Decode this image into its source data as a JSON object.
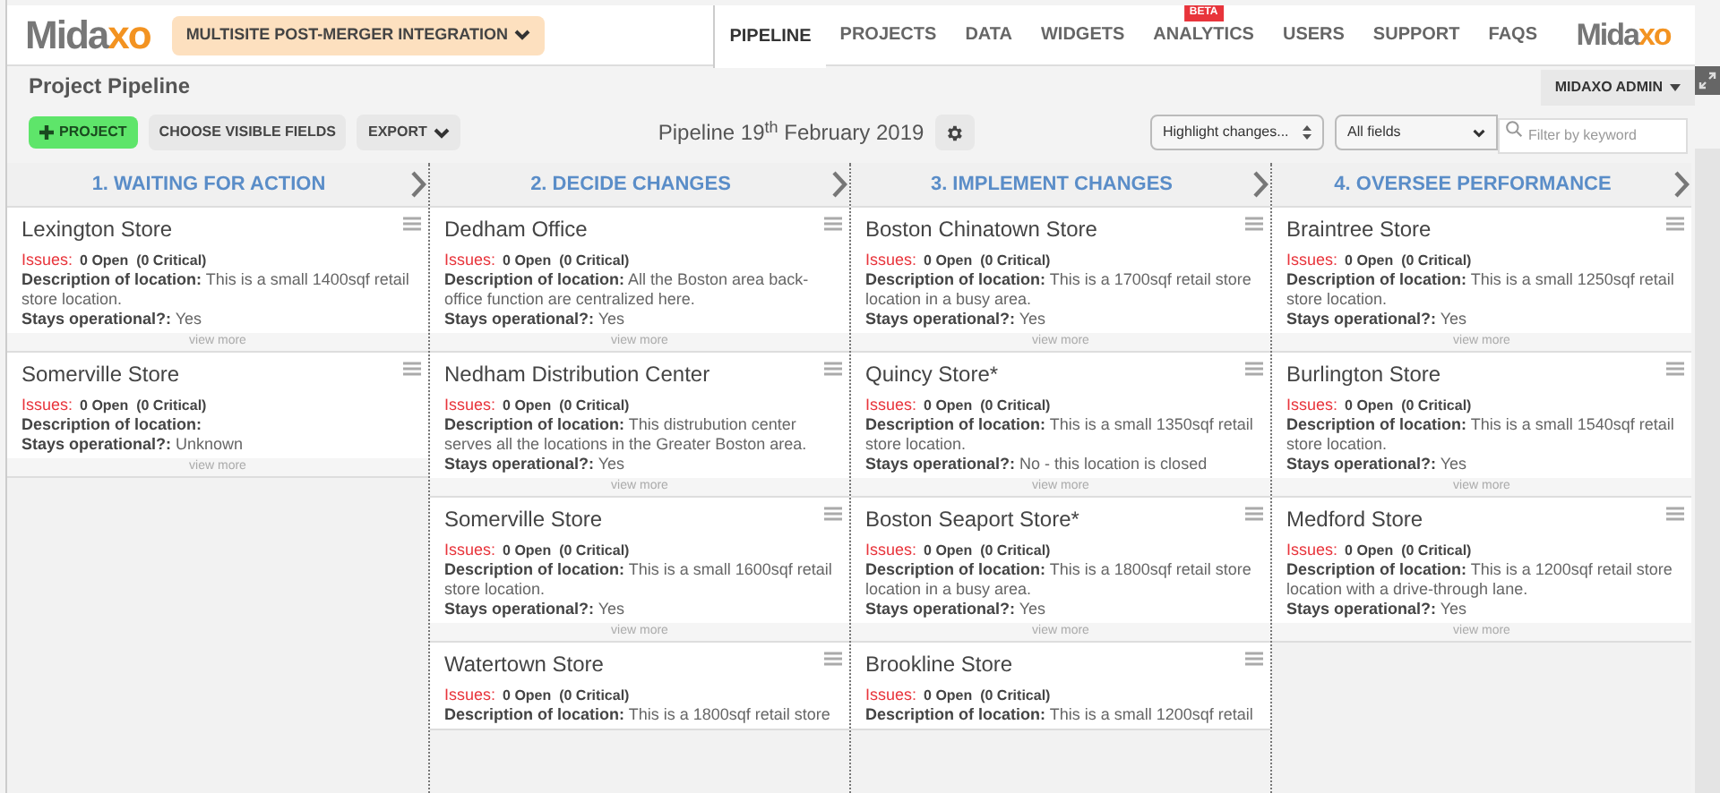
{
  "app": {
    "logo": {
      "main": "Mida",
      "accent": "xo"
    },
    "project_selector": "MULTISITE POST-MERGER INTEGRATION"
  },
  "nav": [
    {
      "label": "PIPELINE",
      "selected": true
    },
    {
      "label": "PROJECTS",
      "selected": false
    },
    {
      "label": "DATA",
      "selected": false
    },
    {
      "label": "WIDGETS",
      "selected": false
    },
    {
      "label": "ANALYTICS",
      "selected": false,
      "badge": "BETA"
    },
    {
      "label": "USERS",
      "selected": false
    },
    {
      "label": "SUPPORT",
      "selected": false
    },
    {
      "label": "FAQS",
      "selected": false
    }
  ],
  "brand_logo": {
    "main": "Mida",
    "accent": "xo"
  },
  "page_title": "Project Pipeline",
  "user_menu": "MIDAXO ADMIN",
  "toolbar": {
    "add_button": "PROJECT",
    "choose_fields": "CHOOSE VISIBLE FIELDS",
    "export": "EXPORT",
    "pipeline_date": "Pipeline 19$^{th}$ February 2019",
    "highlight_select": "Highlight changes...",
    "field_select": "All fields",
    "search": {
      "placeholder": "Filter by keyword"
    }
  },
  "columns": [
    {
      "title": "1. WAITING FOR ACTION",
      "cards": [
        {
          "title": "Lexington Store",
          "issues_label": "Issues:",
          "issues": "0 Open  (0 Critical)",
          "fields": [
            "**Description of location:** This is a small 1400sqf retail store location.",
            "**Stays operational?:** Yes"
          ],
          "footer": "view more"
        },
        {
          "title": "Somerville Store",
          "issues_label": "Issues:",
          "issues": "0 Open  (0 Critical)",
          "fields": [
            "**Description of location:**",
            "**Stays operational?:** Unknown"
          ],
          "footer": "view more"
        }
      ]
    },
    {
      "title": "2. DECIDE CHANGES",
      "cards": [
        {
          "title": "Dedham Office",
          "issues_label": "Issues:",
          "issues": "0 Open  (0 Critical)",
          "fields": [
            "**Description of location:** All the Boston area back-office function are centralized here.",
            "**Stays operational?:** Yes"
          ],
          "footer": "view more"
        },
        {
          "title": "Nedham Distribution Center",
          "issues_label": "Issues:",
          "issues": "0 Open  (0 Critical)",
          "fields": [
            "**Description of location:** This distrubution center serves all the locations in the Greater Boston area.",
            "**Stays operational?:** Yes"
          ],
          "footer": "view more"
        },
        {
          "title": "Somerville Store",
          "issues_label": "Issues:",
          "issues": "0 Open  (0 Critical)",
          "fields": [
            "**Description of location:** This is a small 1600sqf retail store location.",
            "**Stays operational?:** Yes"
          ],
          "footer": "view more"
        },
        {
          "title": "Watertown Store",
          "issues_label": "Issues:",
          "issues": "0 Open  (0 Critical)",
          "fields": [
            "**Description of location:** This is a 1800sqf retail store"
          ]
        }
      ]
    },
    {
      "title": "3. IMPLEMENT CHANGES",
      "cards": [
        {
          "title": "Boston Chinatown Store",
          "issues_label": "Issues:",
          "issues": "0 Open  (0 Critical)",
          "fields": [
            "**Description of location:** This is a 1700sqf retail store location in a busy area.",
            "**Stays operational?:** Yes"
          ],
          "footer": "view more"
        },
        {
          "title": "Quincy Store*",
          "issues_label": "Issues:",
          "issues": "0 Open  (0 Critical)",
          "fields": [
            "**Description of location:** This is a small 1350sqf retail store location.",
            "**Stays operational?:** No - this location is closed"
          ],
          "footer": "view more"
        },
        {
          "title": "Boston Seaport Store*",
          "issues_label": "Issues:",
          "issues": "0 Open  (0 Critical)",
          "fields": [
            "**Description of location:** This is a 1800sqf retail store location in a busy area.",
            "**Stays operational?:** Yes"
          ],
          "footer": "view more"
        },
        {
          "title": "Brookline Store",
          "issues_label": "Issues:",
          "issues": "0 Open  (0 Critical)",
          "fields": [
            "**Description of location:** This is a small 1200sqf retail"
          ]
        }
      ]
    },
    {
      "title": "4. OVERSEE PERFORMANCE",
      "cards": [
        {
          "title": "Braintree Store",
          "issues_label": "Issues:",
          "issues": "0 Open  (0 Critical)",
          "fields": [
            "**Description of location:** This is a small 1250sqf retail store location.",
            "**Stays operational?:** Yes"
          ],
          "footer": "view more"
        },
        {
          "title": "Burlington Store",
          "issues_label": "Issues:",
          "issues": "0 Open  (0 Critical)",
          "fields": [
            "**Description of location:** This is a small 1540sqf retail store location.",
            "**Stays operational?:** Yes"
          ],
          "footer": "view more"
        },
        {
          "title": "Medford Store",
          "issues_label": "Issues:",
          "issues": "0 Open  (0 Critical)",
          "fields": [
            "**Description of location:** This is a 1200sqf retail store location with a drive-through lane.",
            "**Stays operational?:** Yes"
          ],
          "footer": "view more"
        }
      ]
    }
  ]
}
